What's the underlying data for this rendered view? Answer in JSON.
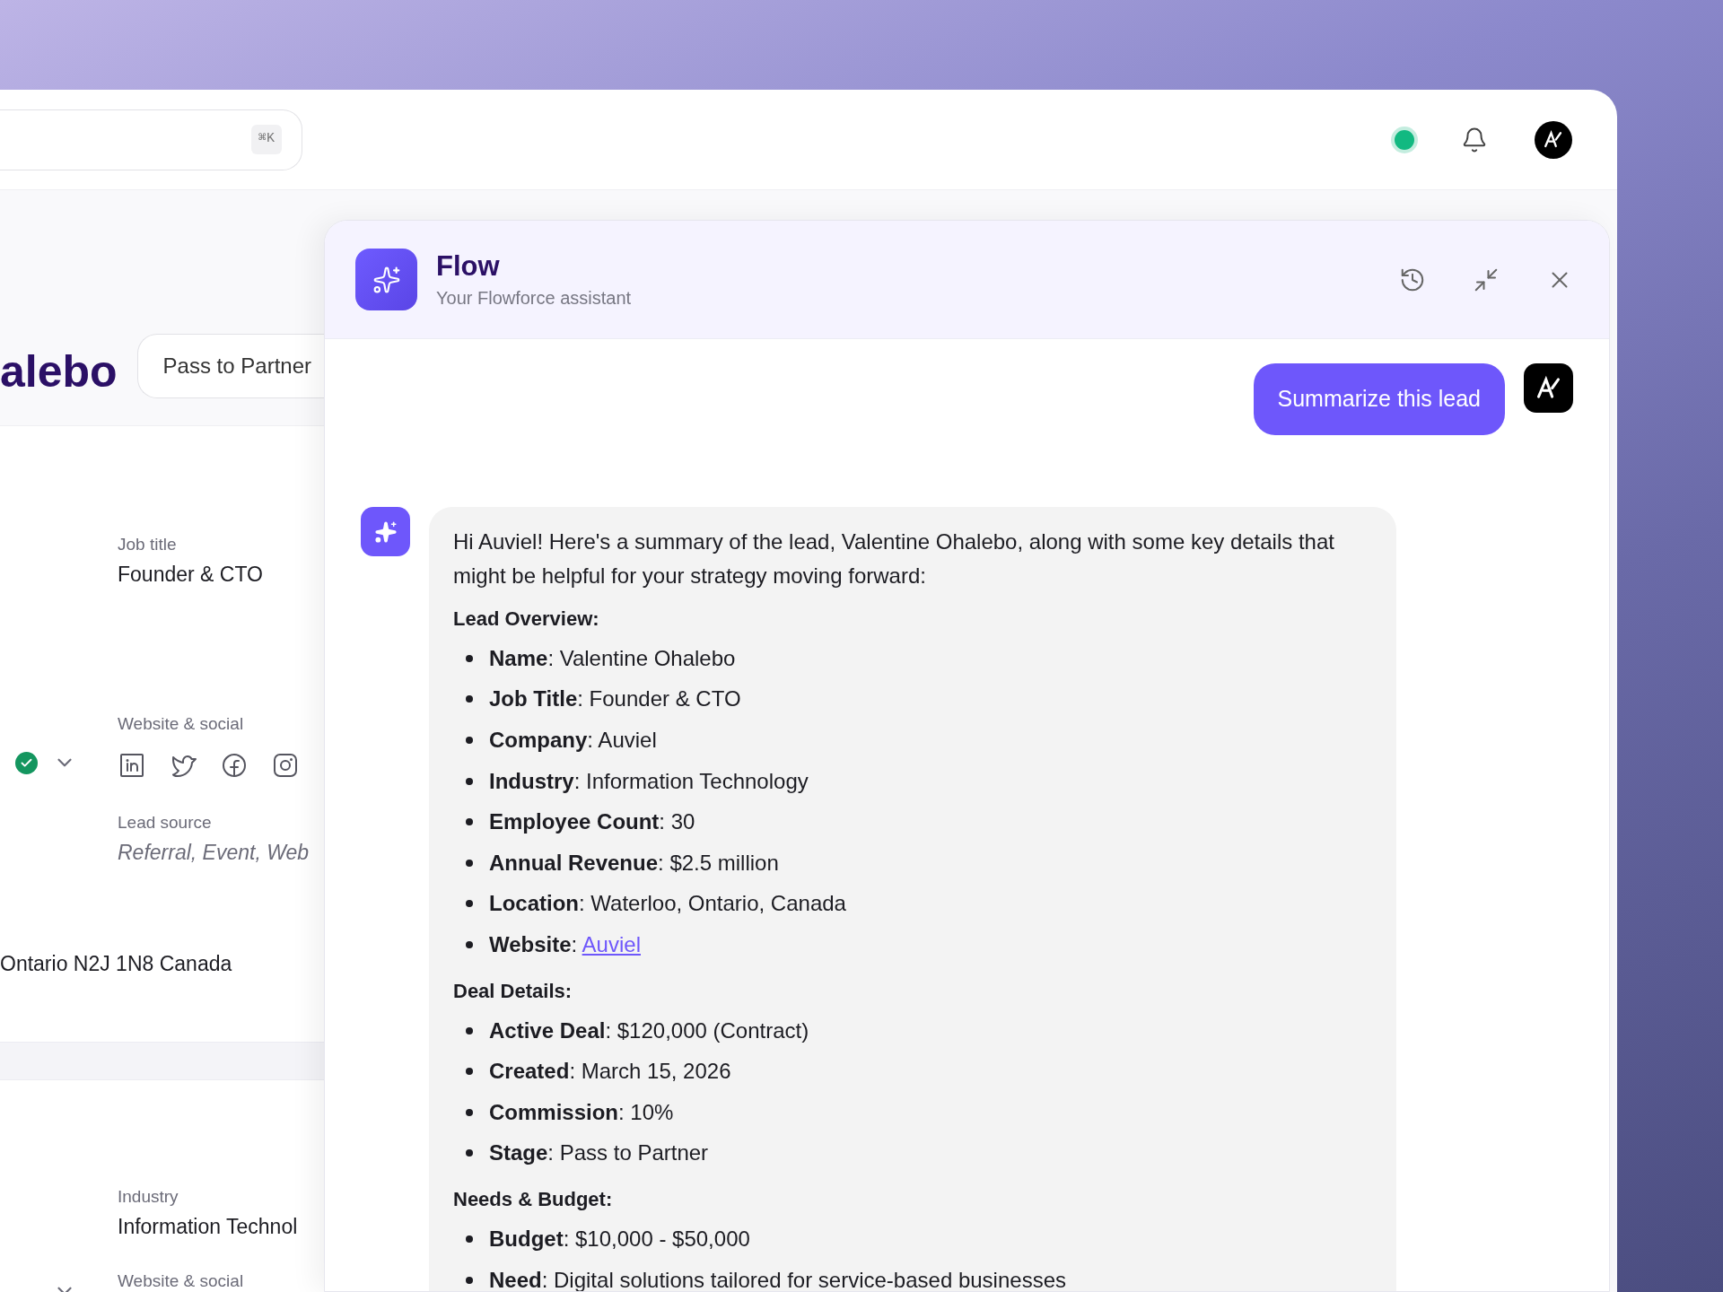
{
  "search": {
    "shortcut": "⌘K"
  },
  "lead": {
    "name": "alebo",
    "stage_button": "Pass to Partner",
    "fields": [
      {
        "kind": "text",
        "label": "Job title",
        "value": "Founder & CTO"
      },
      {
        "kind": "social",
        "label": "Website & social",
        "verified": true
      },
      {
        "kind": "italic",
        "label": "Lead source",
        "value": "Referral, Event, Web"
      },
      {
        "kind": "address",
        "value": "Ontario N2J 1N8 Canada"
      },
      {
        "kind": "band"
      },
      {
        "kind": "text",
        "label": "Industry",
        "value": "Information Technol"
      },
      {
        "kind": "label_only",
        "label": "Website & social",
        "verified": false
      }
    ]
  },
  "assistant": {
    "title": "Flow",
    "subtitle": "Your Flowforce assistant",
    "messages": [
      {
        "kind": "user",
        "text": "Summarize this lead"
      },
      {
        "kind": "assistant",
        "intro": "Hi Auviel! Here's a summary of the lead, Valentine Ohalebo, along with some key details that might be helpful for your strategy moving forward:",
        "sections": [
          {
            "heading": "Lead Overview:",
            "items": [
              {
                "text": "**Name**: Valentine Ohalebo"
              },
              {
                "text": "**Job Title**: Founder & CTO"
              },
              {
                "text": "**Company**: Auviel"
              },
              {
                "text": "**Industry**: Information Technology"
              },
              {
                "text": "**Employee Count**: 30"
              },
              {
                "text": "**Annual Revenue**: $2.5 million"
              },
              {
                "text": "**Location**: Waterloo, Ontario, Canada"
              },
              {
                "text": "**Website**:",
                "link": "Auviel"
              }
            ]
          },
          {
            "heading": "Deal Details:",
            "items": [
              {
                "text": "**Active Deal**: $120,000 (Contract)"
              },
              {
                "text": "**Created**: March 15, 2026"
              },
              {
                "text": "**Commission**: 10%"
              },
              {
                "text": "**Stage**: Pass to Partner"
              }
            ]
          },
          {
            "heading": "Needs & Budget:",
            "items": [
              {
                "text": "**Budget**: $10,000 - $50,000"
              },
              {
                "text": "**Need**: Digital solutions tailored for service-based businesses"
              }
            ]
          }
        ]
      }
    ]
  }
}
